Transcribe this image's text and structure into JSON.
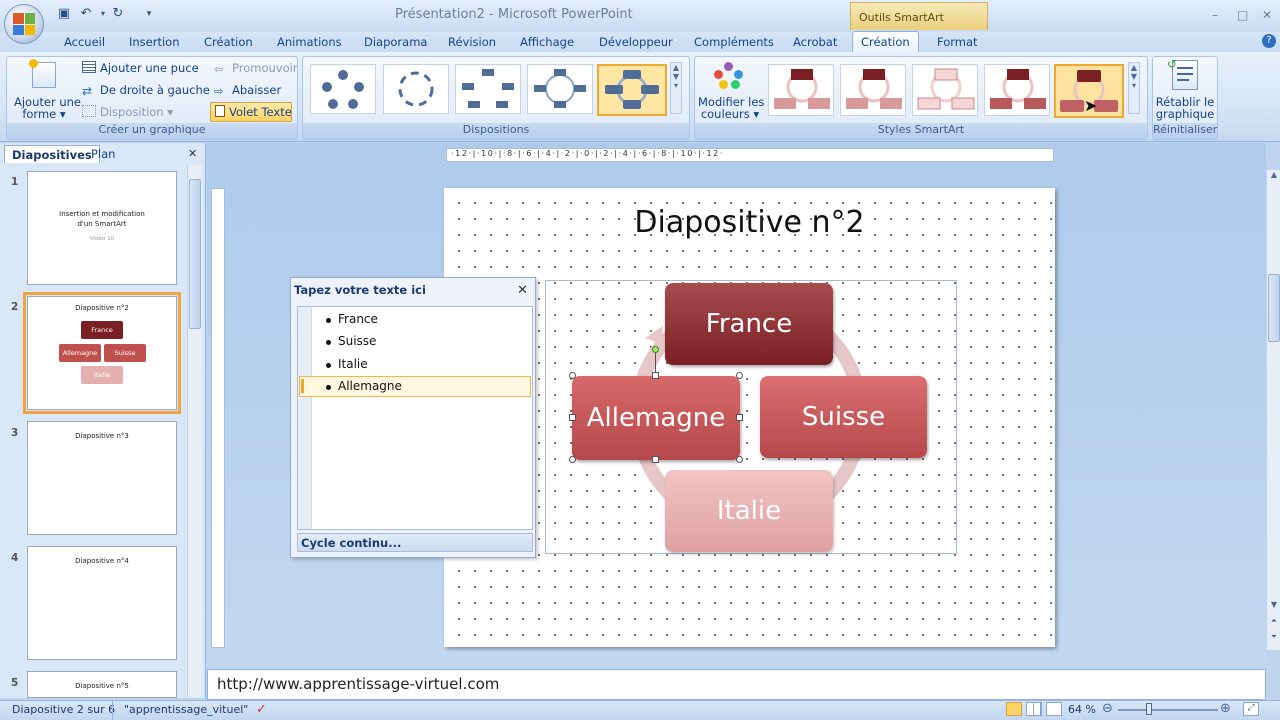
{
  "window": {
    "title": "Présentation2 - Microsoft PowerPoint",
    "contextual_group": "Outils SmartArt",
    "min": "–",
    "max": "□",
    "close": "✕"
  },
  "tabs": [
    "Accueil",
    "Insertion",
    "Création",
    "Animations",
    "Diaporama",
    "Révision",
    "Affichage",
    "Développeur",
    "Compléments",
    "Acrobat",
    "Création",
    "Format"
  ],
  "active_tab_index": 10,
  "ribbon": {
    "create_group": {
      "label": "Créer un graphique",
      "add_shape": "Ajouter une\nforme",
      "add_shape_line1": "Ajouter une",
      "add_shape_line2": "forme ▾",
      "add_bullet": "Ajouter une puce",
      "right_to_left": "De droite à gauche",
      "layout": "Disposition ▾",
      "promote": "Promouvoir",
      "demote": "Abaisser",
      "text_pane": "Volet Texte"
    },
    "layouts_group": {
      "label": "Dispositions"
    },
    "styles_group": {
      "label": "Styles SmartArt",
      "change_colors_line1": "Modifier les",
      "change_colors_line2": "couleurs ▾"
    },
    "reset_group": {
      "label": "Réinitialiser",
      "reset_line1": "Rétablir le",
      "reset_line2": "graphique"
    }
  },
  "left_panel": {
    "tab_slides": "Diapositives",
    "tab_outline": "Plan",
    "close": "✕",
    "slides": [
      {
        "num": "1",
        "title_line1": "Insertion et modification",
        "title_line2": "d'un SmartArt",
        "subtitle": "Vidéo 10"
      },
      {
        "num": "2",
        "title": "Diapositive n°2",
        "items": [
          "France",
          "Allemagne",
          "Suisse",
          "Italie"
        ]
      },
      {
        "num": "3",
        "title": "Diapositive n°3"
      },
      {
        "num": "4",
        "title": "Diapositive n°4"
      },
      {
        "num": "5",
        "title": "Diapositive n°5"
      }
    ]
  },
  "ruler": {
    "marks": "·12·|·10·|·8·|·6·|·4·|·2·|·0·|·2·|·4·|·6·|·8·|·10·|·12·"
  },
  "slide": {
    "title": "Diapositive n°2",
    "smartart": {
      "top": "France",
      "right": "Suisse",
      "left": "Allemagne",
      "bottom": "Italie"
    }
  },
  "text_pane": {
    "title": "Tapez votre texte ici",
    "close": "✕",
    "items": [
      "France",
      "Suisse",
      "Italie",
      "Allemagne"
    ],
    "footer": "Cycle continu..."
  },
  "notes": {
    "text": "http://www.apprentissage-virtuel.com"
  },
  "status": {
    "slide_info": "Diapositive 2 sur 6",
    "theme": "\"apprentissage_vituel\"",
    "zoom": "64 %"
  },
  "colors": {
    "dark_red": "#7a1f24",
    "mid_red": "#c0504d",
    "light_red": "#e6b0b2",
    "accent_orange": "#f3a33c"
  }
}
